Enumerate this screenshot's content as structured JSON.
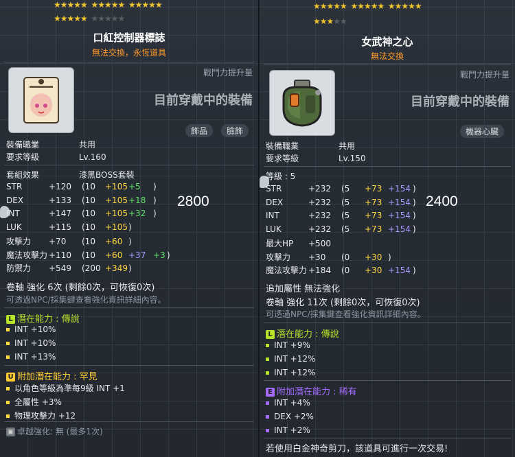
{
  "left": {
    "stars_row1": [
      "★★★★★",
      "★★★★★",
      "★★★★★"
    ],
    "stars_row2_on": "★★★★★",
    "stars_row2_off": "★★★★★",
    "title": "口紅控制器標誌",
    "subtitle": "無法交換，永恆道具",
    "power_label": "戰鬥力提升量",
    "worn_label": "目前穿戴中的裝備",
    "tags": [
      "飾品",
      "臉飾"
    ],
    "job_label": "裝備職業",
    "job_value": "共用",
    "req_label": "要求等級",
    "req_value": "Lv.160",
    "set_label": "套組效果",
    "set_value": "漆黑BOSS套裝",
    "stats": [
      {
        "name": "STR",
        "total": "+120",
        "base": "(10",
        "a": "+105",
        "b": "+5",
        "bcolor": "g",
        "end": ")"
      },
      {
        "name": "DEX",
        "total": "+133",
        "base": "(10",
        "a": "+105",
        "b": "+18",
        "bcolor": "g",
        "end": ")"
      },
      {
        "name": "INT",
        "total": "+147",
        "base": "(10",
        "a": "+105",
        "b": "+32",
        "bcolor": "g",
        "end": ")"
      },
      {
        "name": "LUK",
        "total": "+115",
        "base": "(10",
        "a": "+105",
        "b": "",
        "bcolor": "g",
        "end": ")"
      },
      {
        "name": "攻擊力",
        "total": "+70",
        "base": "(10",
        "a": "+60",
        "b": "",
        "bcolor": "g",
        "end": ")"
      },
      {
        "name": "魔法攻擊力",
        "total": "+110",
        "base": "(10",
        "a": "+60",
        "b": "+37",
        "bcolor": "b",
        "c": "+3",
        "end": ")"
      },
      {
        "name": "防禦力",
        "total": "+549",
        "base": "(200",
        "a": "+349",
        "b": "",
        "bcolor": "g",
        "end": ")"
      }
    ],
    "scroll": "卷軸 強化 6次 (剩餘0次，可恢復0次)",
    "npc_hint": "可透過NPC/採集鍵查看強化資訊詳細內容。",
    "pot_label": "潛在能力 : 傳說",
    "pot_lines": [
      "INT +10%",
      "INT +10%",
      "INT +13%"
    ],
    "add_label": "附加潛在能力 : 罕見",
    "add_lines": [
      "以角色等級為準每9級 INT +1",
      "全屬性 +3%",
      "物理攻擊力 +12"
    ],
    "star_force": "卓越強化:  無 (最多1次)",
    "big_number": "2800"
  },
  "right": {
    "stars_row1": [
      "★★★★★",
      "★★★★★",
      "★★★★★"
    ],
    "stars_row2_on": "★★★",
    "stars_row2_off": "★★",
    "title": "女武神之心",
    "subtitle": "無法交換",
    "power_label": "戰鬥力提升量",
    "worn_label": "目前穿戴中的裝備",
    "tags": [
      "機器心臟"
    ],
    "job_label": "裝備職業",
    "job_value": "共用",
    "req_label": "要求等級",
    "req_value": "Lv.150",
    "level_label": "等級 : 5",
    "stats": [
      {
        "name": "STR",
        "total": "+232",
        "base": "(5",
        "a": "+73",
        "b": "+154",
        "bcolor": "b",
        "end": ")"
      },
      {
        "name": "DEX",
        "total": "+232",
        "base": "(5",
        "a": "+73",
        "b": "+154",
        "bcolor": "b",
        "end": ")"
      },
      {
        "name": "INT",
        "total": "+232",
        "base": "(5",
        "a": "+73",
        "b": "+154",
        "bcolor": "b",
        "end": ")"
      },
      {
        "name": "LUK",
        "total": "+232",
        "base": "(5",
        "a": "+73",
        "b": "+154",
        "bcolor": "b",
        "end": ")"
      },
      {
        "name": "最大HP",
        "total": "+500",
        "base": "",
        "a": "",
        "b": "",
        "bcolor": "b",
        "end": ""
      },
      {
        "name": "攻擊力",
        "total": "+30",
        "base": "(0",
        "a": "+30",
        "b": "",
        "bcolor": "b",
        "end": ")"
      },
      {
        "name": "魔法攻擊力",
        "total": "+184",
        "base": "(0",
        "a": "+30",
        "b": "+154",
        "bcolor": "b",
        "end": ")"
      }
    ],
    "extra_attr": "追加屬性 無法強化",
    "scroll": "卷軸 強化 11次 (剩餘0次，可恢復0次)",
    "npc_hint": "可透過NPC/採集鍵查看強化資訊詳細內容。",
    "pot_label": "潛在能力 : 傳說",
    "pot_lines": [
      "INT +9%",
      "INT +12%",
      "INT +12%"
    ],
    "add_label": "附加潛在能力 : 稀有",
    "add_lines": [
      "INT +4%",
      "DEX +2%",
      "INT +2%"
    ],
    "scissors": "若使用白金神奇剪刀，該道具可進行一次交易!",
    "big_number": "2400"
  },
  "colors": {
    "legendary": "#b6e42a",
    "rare": "#5aa8ff",
    "epic": "#a36bff",
    "unique": "#ffcc33"
  }
}
